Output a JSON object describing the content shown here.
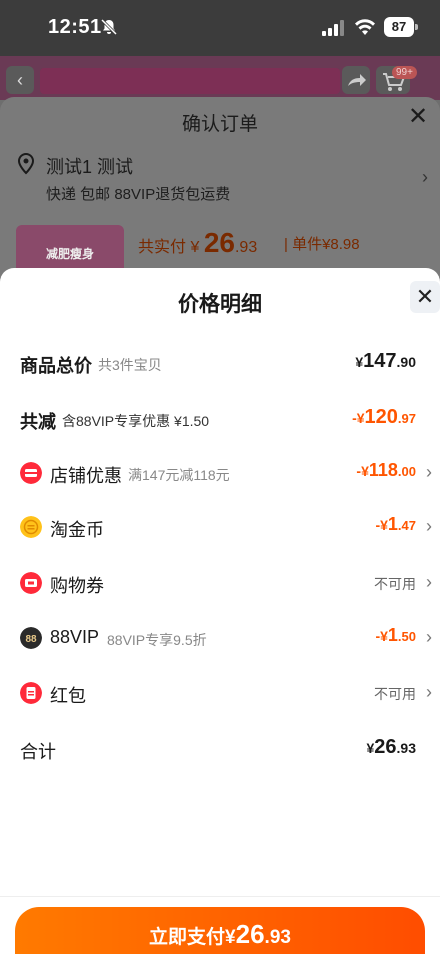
{
  "status_bar": {
    "time": "12:51",
    "battery": "87"
  },
  "page_header": {
    "badge": "99+"
  },
  "confirm_order": {
    "title": "确认订单",
    "address": "测试1 测试",
    "shipping": "快递 包邮 88VIP退货包运费",
    "thumb_text": "减肥瘦身",
    "total_label": "共实付",
    "total_currency": "¥",
    "total_int": "26",
    "total_dec": ".93",
    "unit_price": "| 单件¥8.98"
  },
  "price_detail": {
    "title": "价格明细",
    "subtotal": {
      "label": "商品总价",
      "note": "共3件宝贝",
      "currency": "¥",
      "int": "147",
      "dec": ".90"
    },
    "discount": {
      "label": "共减",
      "note": "含88VIP专享优惠 ¥1.50",
      "prefix": "-¥",
      "int": "120",
      "dec": ".97"
    },
    "items": [
      {
        "label": "店铺优惠",
        "note": "满147元减118元",
        "prefix": "-¥",
        "int": "118",
        "dec": ".00",
        "icon": "store-coupon-icon"
      },
      {
        "label": "淘金币",
        "note": "",
        "prefix": "-¥",
        "int": "1",
        "dec": ".47",
        "icon": "gold-coin-icon"
      },
      {
        "label": "购物券",
        "note": "",
        "status": "不可用",
        "icon": "shopping-voucher-icon"
      },
      {
        "label": "88VIP",
        "note": "88VIP专享9.5折",
        "prefix": "-¥",
        "int": "1",
        "dec": ".50",
        "icon": "vip88-icon"
      },
      {
        "label": "红包",
        "note": "",
        "status": "不可用",
        "icon": "red-packet-icon"
      }
    ],
    "total": {
      "label": "合计",
      "currency": "¥",
      "int": "26",
      "dec": ".93"
    }
  },
  "pay_button": {
    "label": "立即支付",
    "currency": "¥",
    "int": "26",
    "dec": ".93"
  },
  "colors": {
    "accent": "#ff5500",
    "pay_start": "#ff7a00",
    "pay_end": "#ff4d00"
  }
}
